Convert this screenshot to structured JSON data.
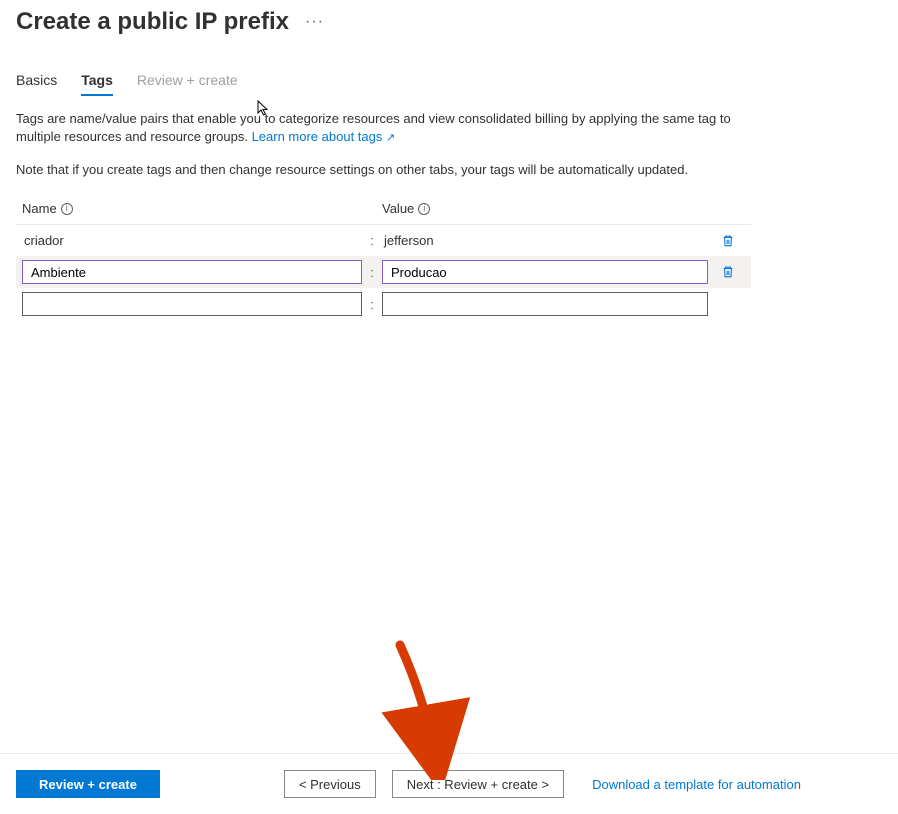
{
  "header": {
    "title": "Create a public IP prefix",
    "more": "···"
  },
  "tabs": {
    "basics": "Basics",
    "tags": "Tags",
    "review": "Review + create"
  },
  "desc": {
    "text1": "Tags are name/value pairs that enable you to categorize resources and view consolidated billing by applying the same tag to multiple resources and resource groups. ",
    "link": "Learn more about tags",
    "note": "Note that if you create tags and then change resource settings on other tabs, your tags will be automatically updated."
  },
  "table": {
    "name_header": "Name",
    "value_header": "Value",
    "rows": [
      {
        "name": "criador",
        "value": "jefferson",
        "readonly": true,
        "deletable": true
      },
      {
        "name": "Ambiente",
        "value": "Producao",
        "readonly": false,
        "active": true,
        "deletable": true
      },
      {
        "name": "",
        "value": "",
        "readonly": false,
        "deletable": false
      }
    ]
  },
  "footer": {
    "review": "Review + create",
    "prev": "< Previous",
    "next": "Next : Review + create >",
    "download": "Download a template for automation"
  }
}
